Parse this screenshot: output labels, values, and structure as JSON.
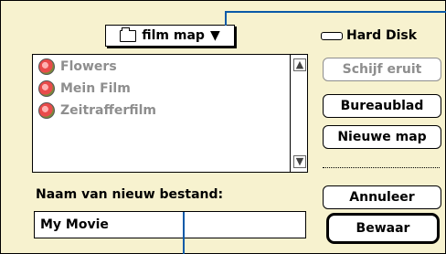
{
  "folder_popup": {
    "label": "film map",
    "arrow": "▼",
    "icon": "folder-icon"
  },
  "disk": {
    "label": "Hard Disk",
    "icon": "hard-disk-icon"
  },
  "file_list": [
    {
      "name": "Flowers"
    },
    {
      "name": "Mein Film"
    },
    {
      "name": "Zeitrafferfilm"
    }
  ],
  "buttons": {
    "eject": "Schijf eruit",
    "desktop": "Bureaublad",
    "new_folder": "Nieuwe map",
    "cancel": "Annuleer",
    "save": "Bewaar"
  },
  "save_field": {
    "label": "Naam van nieuw bestand:",
    "value": "My Movie"
  },
  "colors": {
    "dialog_bg": "#f7f2cf",
    "callout": "#0a5aa8",
    "disabled": "#8e8e8e"
  }
}
